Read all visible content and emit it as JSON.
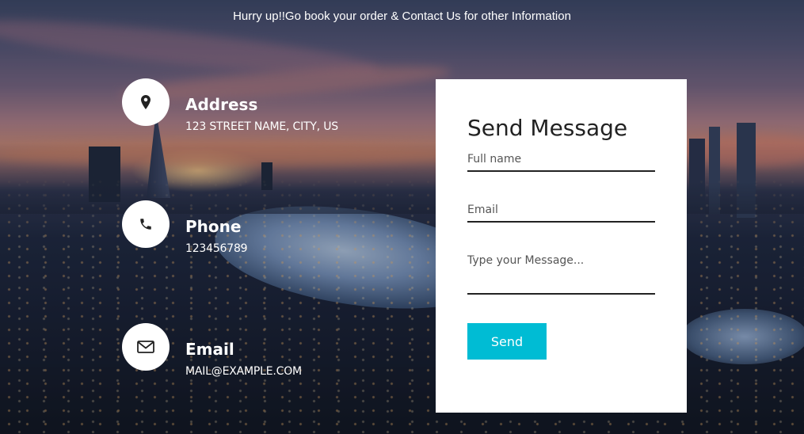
{
  "header": {
    "text": "Hurry up!!Go book your order & Contact Us for other Information"
  },
  "contact_info": [
    {
      "icon": "map-pin-icon",
      "title": "Address",
      "value": "123 STREET NAME, CITY, US"
    },
    {
      "icon": "phone-icon",
      "title": "Phone",
      "value": "123456789"
    },
    {
      "icon": "envelope-icon",
      "title": "Email",
      "value": "MAIL@EXAMPLE.COM"
    }
  ],
  "form": {
    "title": "Send Message",
    "name_placeholder": "Full name",
    "email_placeholder": "Email",
    "message_placeholder": "Type your Message...",
    "send_label": "Send"
  },
  "colors": {
    "accent": "#00bcd4",
    "card": "#ffffff",
    "text_dark": "#222222"
  }
}
